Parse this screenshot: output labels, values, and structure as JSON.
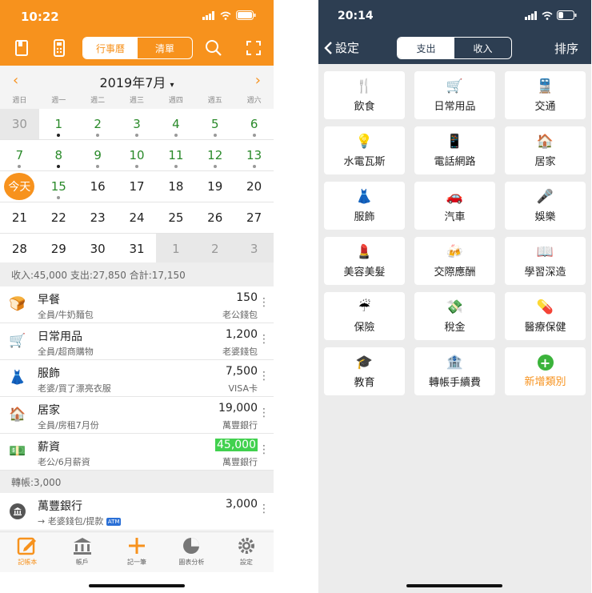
{
  "left": {
    "status": {
      "time": "10:22"
    },
    "header": {
      "tab_calendar": "行事曆",
      "tab_list": "清單"
    },
    "calendar": {
      "month_title": "2019年7月",
      "weekdays": [
        "週日",
        "週一",
        "週二",
        "週三",
        "週四",
        "週五",
        "週六"
      ],
      "weeks": [
        [
          "30",
          "1",
          "2",
          "3",
          "4",
          "5",
          "6"
        ],
        [
          "7",
          "8",
          "9",
          "10",
          "11",
          "12",
          "13"
        ],
        [
          "今天",
          "15",
          "16",
          "17",
          "18",
          "19",
          "20"
        ],
        [
          "21",
          "22",
          "23",
          "24",
          "25",
          "26",
          "27"
        ],
        [
          "28",
          "29",
          "30",
          "31",
          "1",
          "2",
          "3"
        ]
      ]
    },
    "summary": "收入:45,000 支出:27,850 合計:17,150",
    "transactions": [
      {
        "icon": "bread-icon",
        "glyph": "🍞",
        "title": "早餐",
        "subtitle": "全員/牛奶麵包",
        "amount": "150",
        "account": "老公錢包"
      },
      {
        "icon": "cart-icon",
        "glyph": "🛒",
        "title": "日常用品",
        "subtitle": "全員/超商購物",
        "amount": "1,200",
        "account": "老婆錢包"
      },
      {
        "icon": "dress-icon",
        "glyph": "👗",
        "title": "服飾",
        "subtitle": "老婆/買了漂亮衣服",
        "amount": "7,500",
        "account": "VISA卡"
      },
      {
        "icon": "house-icon",
        "glyph": "🏠",
        "title": "居家",
        "subtitle": "全員/房租7月份",
        "amount": "19,000",
        "account": "萬豐銀行"
      },
      {
        "icon": "money-icon",
        "glyph": "💵",
        "title": "薪資",
        "subtitle": "老公/6月薪資",
        "amount": "45,000",
        "account": "萬豐銀行"
      }
    ],
    "transfer_header": "轉帳:3,000",
    "transfer": {
      "title": "萬豐銀行",
      "subtitle": "→ 老婆錢包/提款",
      "atm": "ATM",
      "amount": "3,000"
    },
    "tabs": [
      "記帳本",
      "帳戶",
      "記一筆",
      "圖表分析",
      "設定"
    ],
    "colors": {
      "accent": "#f7921d",
      "income_highlight": "#41d14e"
    }
  },
  "right": {
    "status": {
      "time": "20:14"
    },
    "header": {
      "back": "設定",
      "tab_expense": "支出",
      "tab_income": "收入",
      "sort": "排序"
    },
    "categories": [
      {
        "icon": "fork-knife-icon",
        "glyph": "🍴",
        "label": "飲食"
      },
      {
        "icon": "cart-icon",
        "glyph": "🛒",
        "label": "日常用品"
      },
      {
        "icon": "train-icon",
        "glyph": "🚆",
        "label": "交通"
      },
      {
        "icon": "lightbulb-icon",
        "glyph": "💡",
        "label": "水電瓦斯"
      },
      {
        "icon": "phone-icon",
        "glyph": "📱",
        "label": "電話網路"
      },
      {
        "icon": "house-icon",
        "glyph": "🏠",
        "label": "居家"
      },
      {
        "icon": "dress-icon",
        "glyph": "👗",
        "label": "服飾"
      },
      {
        "icon": "car-icon",
        "glyph": "🚗",
        "label": "汽車"
      },
      {
        "icon": "microphone-icon",
        "glyph": "🎤",
        "label": "娛樂"
      },
      {
        "icon": "lipstick-icon",
        "glyph": "💄",
        "label": "美容美髮"
      },
      {
        "icon": "beer-icon",
        "glyph": "🍻",
        "label": "交際應酬"
      },
      {
        "icon": "book-icon",
        "glyph": "📖",
        "label": "學習深造"
      },
      {
        "icon": "umbrella-icon",
        "glyph": "☔",
        "label": "保險"
      },
      {
        "icon": "money-bag-icon",
        "glyph": "💸",
        "label": "稅金"
      },
      {
        "icon": "pill-icon",
        "glyph": "💊",
        "label": "醫療保健"
      },
      {
        "icon": "graduation-cap-icon",
        "glyph": "🎓",
        "label": "教育"
      },
      {
        "icon": "bank-icon",
        "glyph": "🏦",
        "label": "轉帳手續費"
      }
    ],
    "add_category": "新增類別",
    "colors": {
      "header_bg": "#2d3e52",
      "add_accent": "#f7921d",
      "add_icon": "#3bb33b"
    }
  }
}
